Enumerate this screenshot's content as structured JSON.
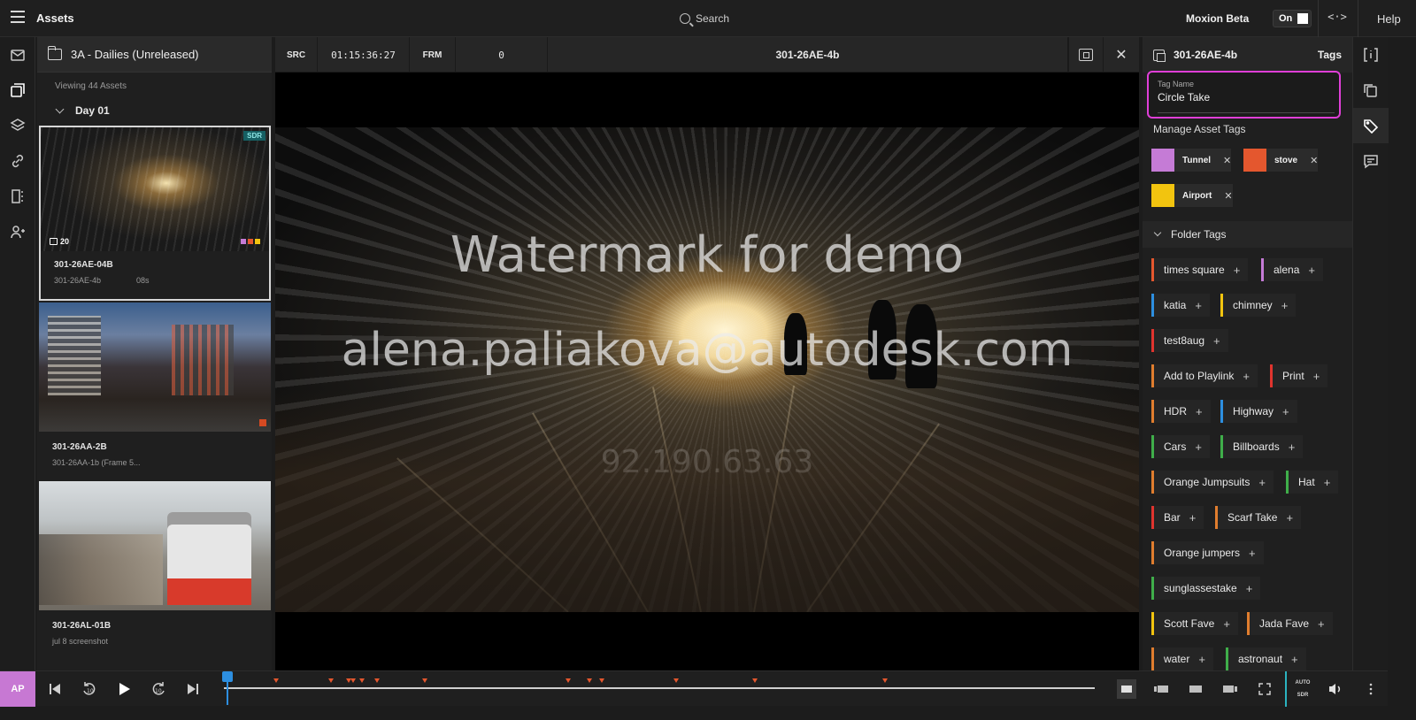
{
  "app": {
    "title": "Assets"
  },
  "search": {
    "label": "Search"
  },
  "beta": {
    "label": "Moxion Beta",
    "toggle": "On"
  },
  "help": {
    "label": "Help"
  },
  "browser": {
    "title": "3A - Dailies (Unreleased)",
    "viewing": "Viewing 44 Assets",
    "group": "Day 01",
    "assets": [
      {
        "name": "301-26AE-04B",
        "sub": "301-26AE-4b",
        "duration": "08s",
        "badge": "SDR",
        "comments": "20",
        "tag_colors": [
          "#c57bd6",
          "#e4572e",
          "#f2c40f"
        ]
      },
      {
        "name": "301-26AA-2B",
        "sub": "301-26AA-1b (Frame 5...",
        "duration": "",
        "tag_colors": [
          "#e4572e"
        ]
      },
      {
        "name": "301-26AL-01B",
        "sub": "jul 8 screenshot",
        "duration": ""
      }
    ]
  },
  "viewer": {
    "src_label": "SRC",
    "timecode": "01:15:36:27",
    "frm_label": "FRM",
    "frame": "0",
    "title": "301-26AE-4b",
    "watermark_line1": "Watermark for demo",
    "watermark_line2": "alena.paliakova@autodesk.com",
    "watermark_line3": "92.190.63.63"
  },
  "tags_panel": {
    "asset_title": "301-26AE-4b",
    "tab": "Tags",
    "tag_name_label": "Tag Name",
    "tag_name_value": "Circle Take",
    "manage_label": "Manage Asset Tags",
    "asset_tags": [
      {
        "label": "Tunnel",
        "color": "#c57bd6"
      },
      {
        "label": "stove",
        "color": "#e4572e"
      },
      {
        "label": "Airport",
        "color": "#f2c40f"
      }
    ],
    "folder_label": "Folder Tags",
    "folder_tags": [
      {
        "label": "times square",
        "color": "#e4572e"
      },
      {
        "label": "alena",
        "color": "#c57bd6"
      },
      {
        "label": "katia",
        "color": "#2d8fe0"
      },
      {
        "label": "chimney",
        "color": "#f2c40f"
      },
      {
        "label": "test8aug",
        "color": "#e0342e"
      },
      {
        "label": "Add to Playlink",
        "color": "#e07d2e"
      },
      {
        "label": "Print",
        "color": "#e0342e"
      },
      {
        "label": "HDR",
        "color": "#e07d2e"
      },
      {
        "label": "Highway",
        "color": "#2d8fe0"
      },
      {
        "label": "Cars",
        "color": "#3fae4a"
      },
      {
        "label": "Billboards",
        "color": "#3fae4a"
      },
      {
        "label": "Orange Jumpsuits",
        "color": "#e07d2e"
      },
      {
        "label": "Hat",
        "color": "#3fae4a"
      },
      {
        "label": "Bar",
        "color": "#e0342e"
      },
      {
        "label": "Scarf Take",
        "color": "#e07d2e"
      },
      {
        "label": "Orange jumpers",
        "color": "#e07d2e"
      },
      {
        "label": "sunglassestake",
        "color": "#3fae4a"
      },
      {
        "label": "Scott Fave",
        "color": "#f2c40f"
      },
      {
        "label": "Jada Fave",
        "color": "#e07d2e"
      },
      {
        "label": "water",
        "color": "#e07d2e"
      },
      {
        "label": "astronaut",
        "color": "#3fae4a"
      }
    ]
  },
  "transport": {
    "avatar": "AP",
    "auto_label": "AUTO",
    "sdr_label": "SDR",
    "playhead_fraction": 0.003
  },
  "colors": {
    "accent_pink": "#e03fd8",
    "playhead_blue": "#2d8fe0"
  }
}
